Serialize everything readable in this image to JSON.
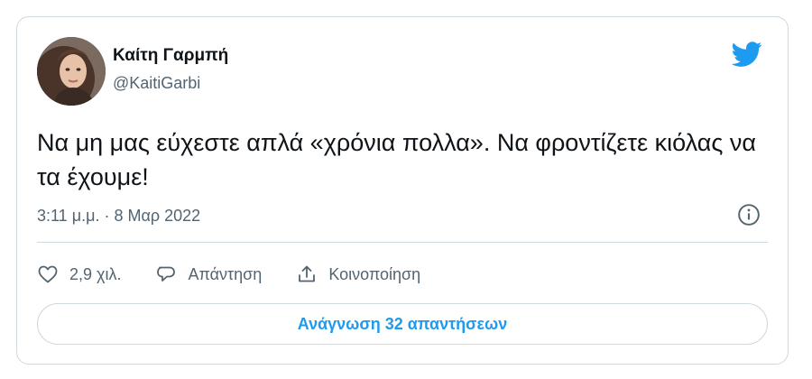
{
  "tweet": {
    "author_name": "Καίτη Γαρμπή",
    "author_handle": "@KaitiGarbi",
    "text": "Να μη μας εύχεστε απλά «χρόνια πολλα». Να φροντίζετε κιόλας να τα έχουμε!",
    "timestamp": "3:11 μ.μ. · 8 Μαρ 2022"
  },
  "actions": {
    "like_count": "2,9 χιλ.",
    "reply_label": "Απάντηση",
    "share_label": "Κοινοποίηση"
  },
  "replies_button": {
    "label": "Ανάγνωση 32 απαντήσεων"
  },
  "icons": {
    "brand": "twitter-bird-icon",
    "info": "info-icon",
    "like": "heart-icon",
    "reply": "reply-bubble-icon",
    "share": "share-icon"
  },
  "colors": {
    "brand_blue": "#1d9bf0",
    "text_primary": "#0f1419",
    "text_secondary": "#536471",
    "border": "#cfd9de"
  }
}
